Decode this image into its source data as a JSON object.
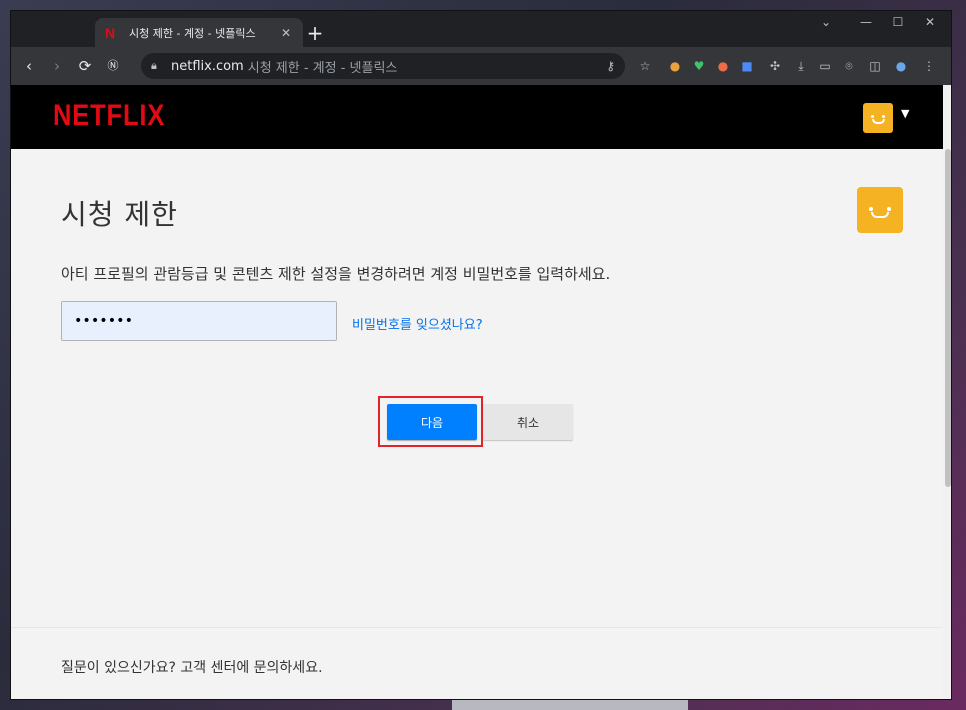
{
  "browser": {
    "tab_title": "시청 제한 - 계정 - 넷플릭스",
    "tab_favicon": "N",
    "new_tab": "+",
    "url_host": "netflix.com",
    "url_rest": "시청 제한 - 계정 - 넷플릭스",
    "window_controls": [
      "⌄",
      "—",
      "☐",
      "✕"
    ]
  },
  "header": {
    "logo": "NETFLIX",
    "profile_color": "#f5b324"
  },
  "main": {
    "title": "시청 제한",
    "instruction": "아티 프로필의 관람등급 및 콘텐츠 제한 설정을 변경하려면 계정 비밀번호를 입력하세요.",
    "password_value": "•••••••",
    "forgot_link": "비밀번호를 잊으셨나요?",
    "next_button": "다음",
    "cancel_button": "취소"
  },
  "footer": {
    "text": "질문이 있으신가요? 고객 센터에 문의하세요."
  },
  "colors": {
    "brand": "#e50914",
    "primary_button": "#0080ff",
    "link": "#0071eb",
    "highlight_box": "#e0242b"
  }
}
